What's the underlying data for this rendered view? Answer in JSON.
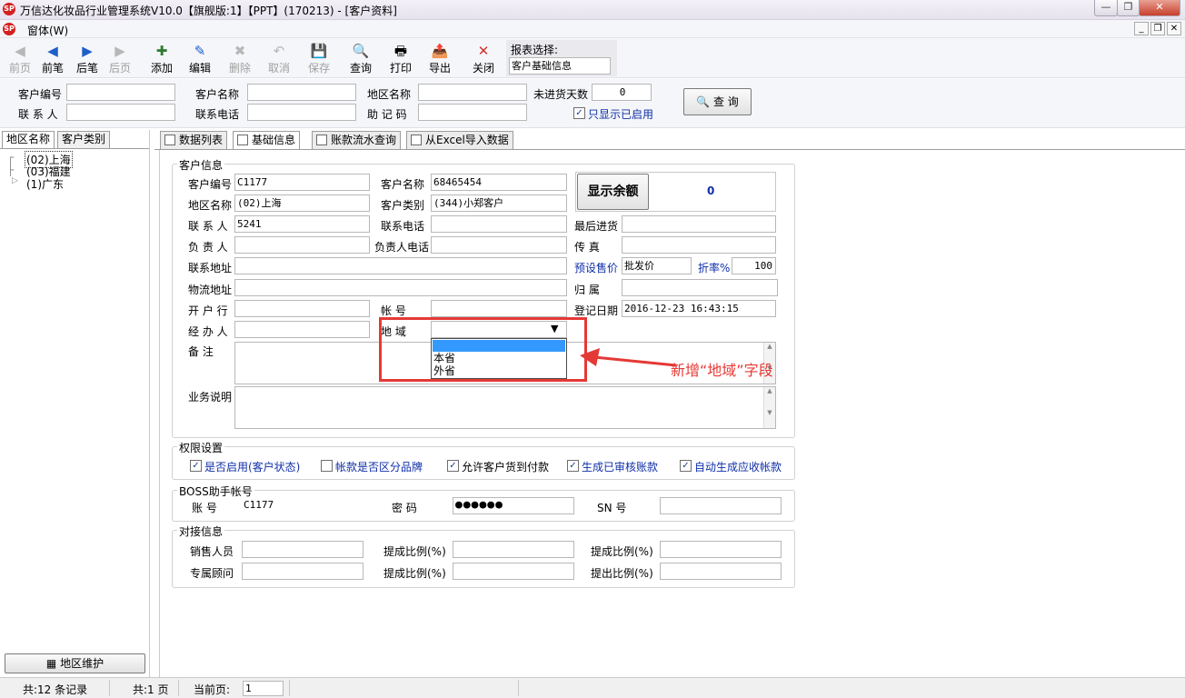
{
  "window": {
    "title": "万信达化妆品行业管理系统V10.0【旗舰版:1】【PPT】(170213) - [客户资料]",
    "logo_text": "SP"
  },
  "menu": {
    "label": "窗体(W)"
  },
  "toolbar": {
    "items": [
      {
        "icon": "◀",
        "label": "前页",
        "enabled": false
      },
      {
        "icon": "◀",
        "label": "前笔",
        "enabled": true
      },
      {
        "icon": "▶",
        "label": "后笔",
        "enabled": true
      },
      {
        "icon": "▶",
        "label": "后页",
        "enabled": false
      },
      {
        "icon": "✚",
        "label": "添加",
        "enabled": true
      },
      {
        "icon": "✎",
        "label": "编辑",
        "enabled": true
      },
      {
        "icon": "✖",
        "label": "删除",
        "enabled": false
      },
      {
        "icon": "↶",
        "label": "取消",
        "enabled": false
      },
      {
        "icon": "💾",
        "label": "保存",
        "enabled": false
      },
      {
        "icon": "🔍",
        "label": "查询",
        "enabled": true
      },
      {
        "icon": "🖶",
        "label": "打印",
        "enabled": true
      },
      {
        "icon": "📤",
        "label": "导出",
        "enabled": true
      },
      {
        "icon": "✕",
        "label": "关闭",
        "enabled": true
      }
    ],
    "report_label": "报表选择:",
    "report_value": "客户基础信息"
  },
  "filter": {
    "customer_code_label": "客户编号",
    "customer_name_label": "客户名称",
    "region_label": "地区名称",
    "days_label": "未进货天数",
    "days_value": "0",
    "contact_label": "联 系 人",
    "phone_label": "联系电话",
    "mnemonic_label": "助 记 码",
    "only_enabled_label": "只显示已启用",
    "query_button": "查 询"
  },
  "left": {
    "tabs": [
      "地区名称",
      "客户类别"
    ],
    "tree": [
      "(02)上海",
      "(03)福建",
      "(1)广东"
    ],
    "maintain_button": "地区维护"
  },
  "tabs": [
    "数据列表",
    "基础信息",
    "账款流水查询",
    "从Excel导入数据"
  ],
  "customer": {
    "section": "客户信息",
    "code_label": "客户编号",
    "code": "C1177",
    "name_label": "客户名称",
    "name": "68465454",
    "region_label": "地区名称",
    "region": "(02)上海",
    "type_label": "客户类别",
    "type": "(344)小郑客户",
    "contact_label": "联 系 人",
    "contact": "5241",
    "phone_label": "联系电话",
    "principal_label": "负 责 人",
    "principal_phone_label": "负责人电话",
    "address_label": "联系地址",
    "logistics_label": "物流地址",
    "bank_label": "开 户 行",
    "account_label": "帐    号",
    "handler_label": "经 办 人",
    "area_label": "地    域",
    "remark_label": "备    注",
    "business_label": "业务说明",
    "balance_button": "显示余额",
    "balance": "0",
    "last_purchase_label": "最后进货",
    "fax_label": "传    真",
    "preset_price_label": "预设售价",
    "preset_price": "批发价",
    "discount_label": "折率%",
    "discount": "100",
    "belong_label": "归    属",
    "register_date_label": "登记日期",
    "register_date": "2016-12-23 16:43:15",
    "area_options": [
      "",
      "本省",
      "外省"
    ]
  },
  "annotation": {
    "text": "新增“地域”字段",
    "color": "#e53935"
  },
  "permissions": {
    "title": "权限设置",
    "items": [
      {
        "label": "是否启用(客户状态)",
        "checked": true
      },
      {
        "label": "帐款是否区分品牌",
        "checked": false
      },
      {
        "label": "允许客户货到付款",
        "checked": true
      },
      {
        "label": "生成已审核账款",
        "checked": true
      },
      {
        "label": "自动生成应收帐款",
        "checked": true
      }
    ]
  },
  "boss": {
    "title": "BOSS助手帐号",
    "account_label": "账    号",
    "account": "C1177",
    "password_label": "密    码",
    "password": "●●●●●●",
    "sn_label": "SN    号"
  },
  "docking": {
    "title": "对接信息",
    "sales_label": "销售人员",
    "advisor_label": "专属顾问",
    "ratio_label": "提成比例(%)",
    "ratio_label2": "提成比例(%)",
    "ratio_label3": "提成比例(%)",
    "ratio_label4": "提出比例(%)"
  },
  "status": {
    "records": "共:12 条记录",
    "pages": "共:1 页",
    "current_label": "当前页:",
    "current": "1"
  }
}
